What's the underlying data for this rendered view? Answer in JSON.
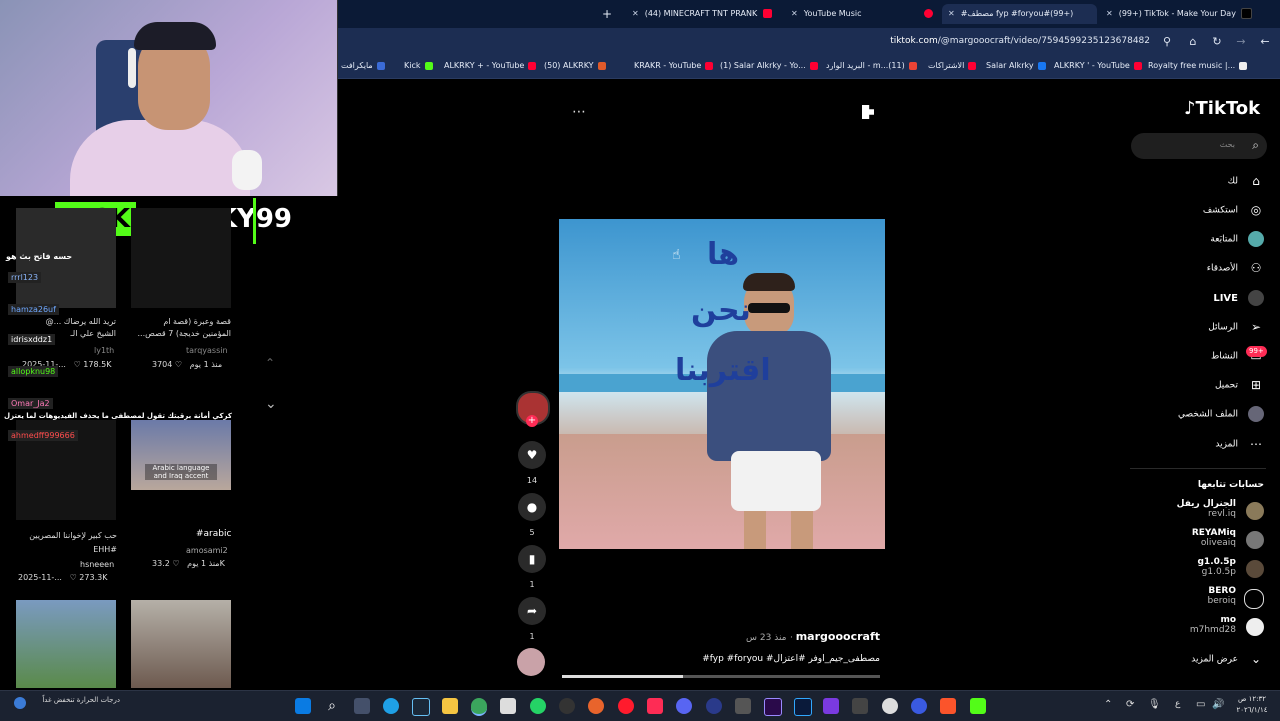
{
  "browser": {
    "tabs": [
      {
        "label": "(99+) TikTok - Make Your Day",
        "active": false
      },
      {
        "label": "#مصطف fyp #foryou#(99+)",
        "active": true
      },
      {
        "label": "YouTube Music",
        "active": false
      },
      {
        "label": "(44) MINECRAFT TNT PRANK",
        "active": false
      }
    ],
    "new_tab": "+",
    "url_domain": "tiktok.com",
    "url_path": "/@margooocraft/video/7594599235123678482",
    "bookmarks": [
      "Royalty free music |...",
      "ALKRKY ' - YouTube",
      "Salar Alkrky",
      "الاشتراكات",
      "البريد الوارد - m...(11)",
      "(1) Salar Alkrky - Yo...",
      "KRAKR - YouTube",
      "(50) ALKRKY",
      "ALKRKY + - YouTube",
      "Kick",
      "مايكرافت"
    ]
  },
  "overlay": {
    "kick_word": "KICK",
    "channel": "ALKRKY99",
    "cards": [
      {
        "title": "قصة وعبرة (قصة ام المؤمنين خديجة) 7 قصص...",
        "author": "tarqyassin",
        "meta": "منذ 1 يوم",
        "likes": "3704"
      },
      {
        "title": "تريد الله يرضاك ...@ الشيخ علي الـ",
        "author": "ly1th",
        "meta": "2025-11-...",
        "likes": "178.5K"
      },
      {
        "title": "#arabic",
        "author": "amosami2",
        "meta": "منذ 1 يوم",
        "likes": "33.2K"
      },
      {
        "title": "حب كبير لإخواننا المصريين #EHH",
        "author": "hsneeen",
        "meta": "2025-11-...",
        "likes": "273.3K"
      }
    ],
    "card_caption": "Arabic language and Iraq accent",
    "chat": [
      {
        "name": "rrrl123",
        "color": "#8ab4f8",
        "msg": "حسه فاتح بث هو"
      },
      {
        "name": "hamza26uf",
        "color": "#6fa8ff",
        "msg": ""
      },
      {
        "name": "idrisxddz1",
        "color": "#ffffff",
        "msg": ""
      },
      {
        "name": "allopknu98",
        "color": "#53fc18",
        "msg": ""
      },
      {
        "name": "Omar_Ja2",
        "color": "#ff7ab8",
        "msg": "كركي أمانة برقبتك تقول لمصطفى ما يحذف الفيديوهات لما يعتزل"
      },
      {
        "name": "ahmedff999666",
        "color": "#ff4d4d",
        "msg": ""
      }
    ]
  },
  "tiktok": {
    "logo": "TikTok",
    "search_placeholder": "بحث",
    "nav": [
      {
        "label": "لك",
        "icon": "home-icon"
      },
      {
        "label": "استكشف",
        "icon": "compass-icon"
      },
      {
        "label": "المتابَعة",
        "icon": "following-icon"
      },
      {
        "label": "الأصدقاء",
        "icon": "friends-icon"
      },
      {
        "label": "LIVE",
        "icon": "live-icon"
      },
      {
        "label": "الرسائل",
        "icon": "send-icon"
      },
      {
        "label": "النشاط",
        "icon": "inbox-icon"
      },
      {
        "label": "تحميل",
        "icon": "upload-icon"
      },
      {
        "label": "الملف الشخصي",
        "icon": "profile-icon"
      },
      {
        "label": "المزيد",
        "icon": "more-icon"
      }
    ],
    "activity_badge": "99+",
    "following_title": "حسابات تتابعها",
    "following": [
      {
        "handle": "الجنرال ريفل",
        "sub": "revl.iq"
      },
      {
        "handle": "REYAMiq",
        "sub": "oliveaiq"
      },
      {
        "handle": "g1.0.5p",
        "sub": "g1.0.5p"
      },
      {
        "handle": "BERO",
        "sub": "beroiq"
      },
      {
        "handle": "mo",
        "sub": "m7hmd28"
      }
    ],
    "see_more": "عرض المزيد",
    "video_text": [
      "ها",
      "نحن",
      "اقتربنا"
    ],
    "actions": {
      "likes": "14",
      "comments": "5",
      "saves": "1",
      "shares": "1"
    },
    "author": "margooocraft",
    "posted": "منذ 23 س",
    "caption": "#fyp #foryou #مصطفى_جيم_اوفر #اعتزال"
  },
  "taskbar": {
    "weather": "درجات الحرارة تنخفض غداً",
    "time": "١٢:٣٢ ص",
    "date": "٢٠٢٦/١/١٤",
    "lang": "ع"
  }
}
